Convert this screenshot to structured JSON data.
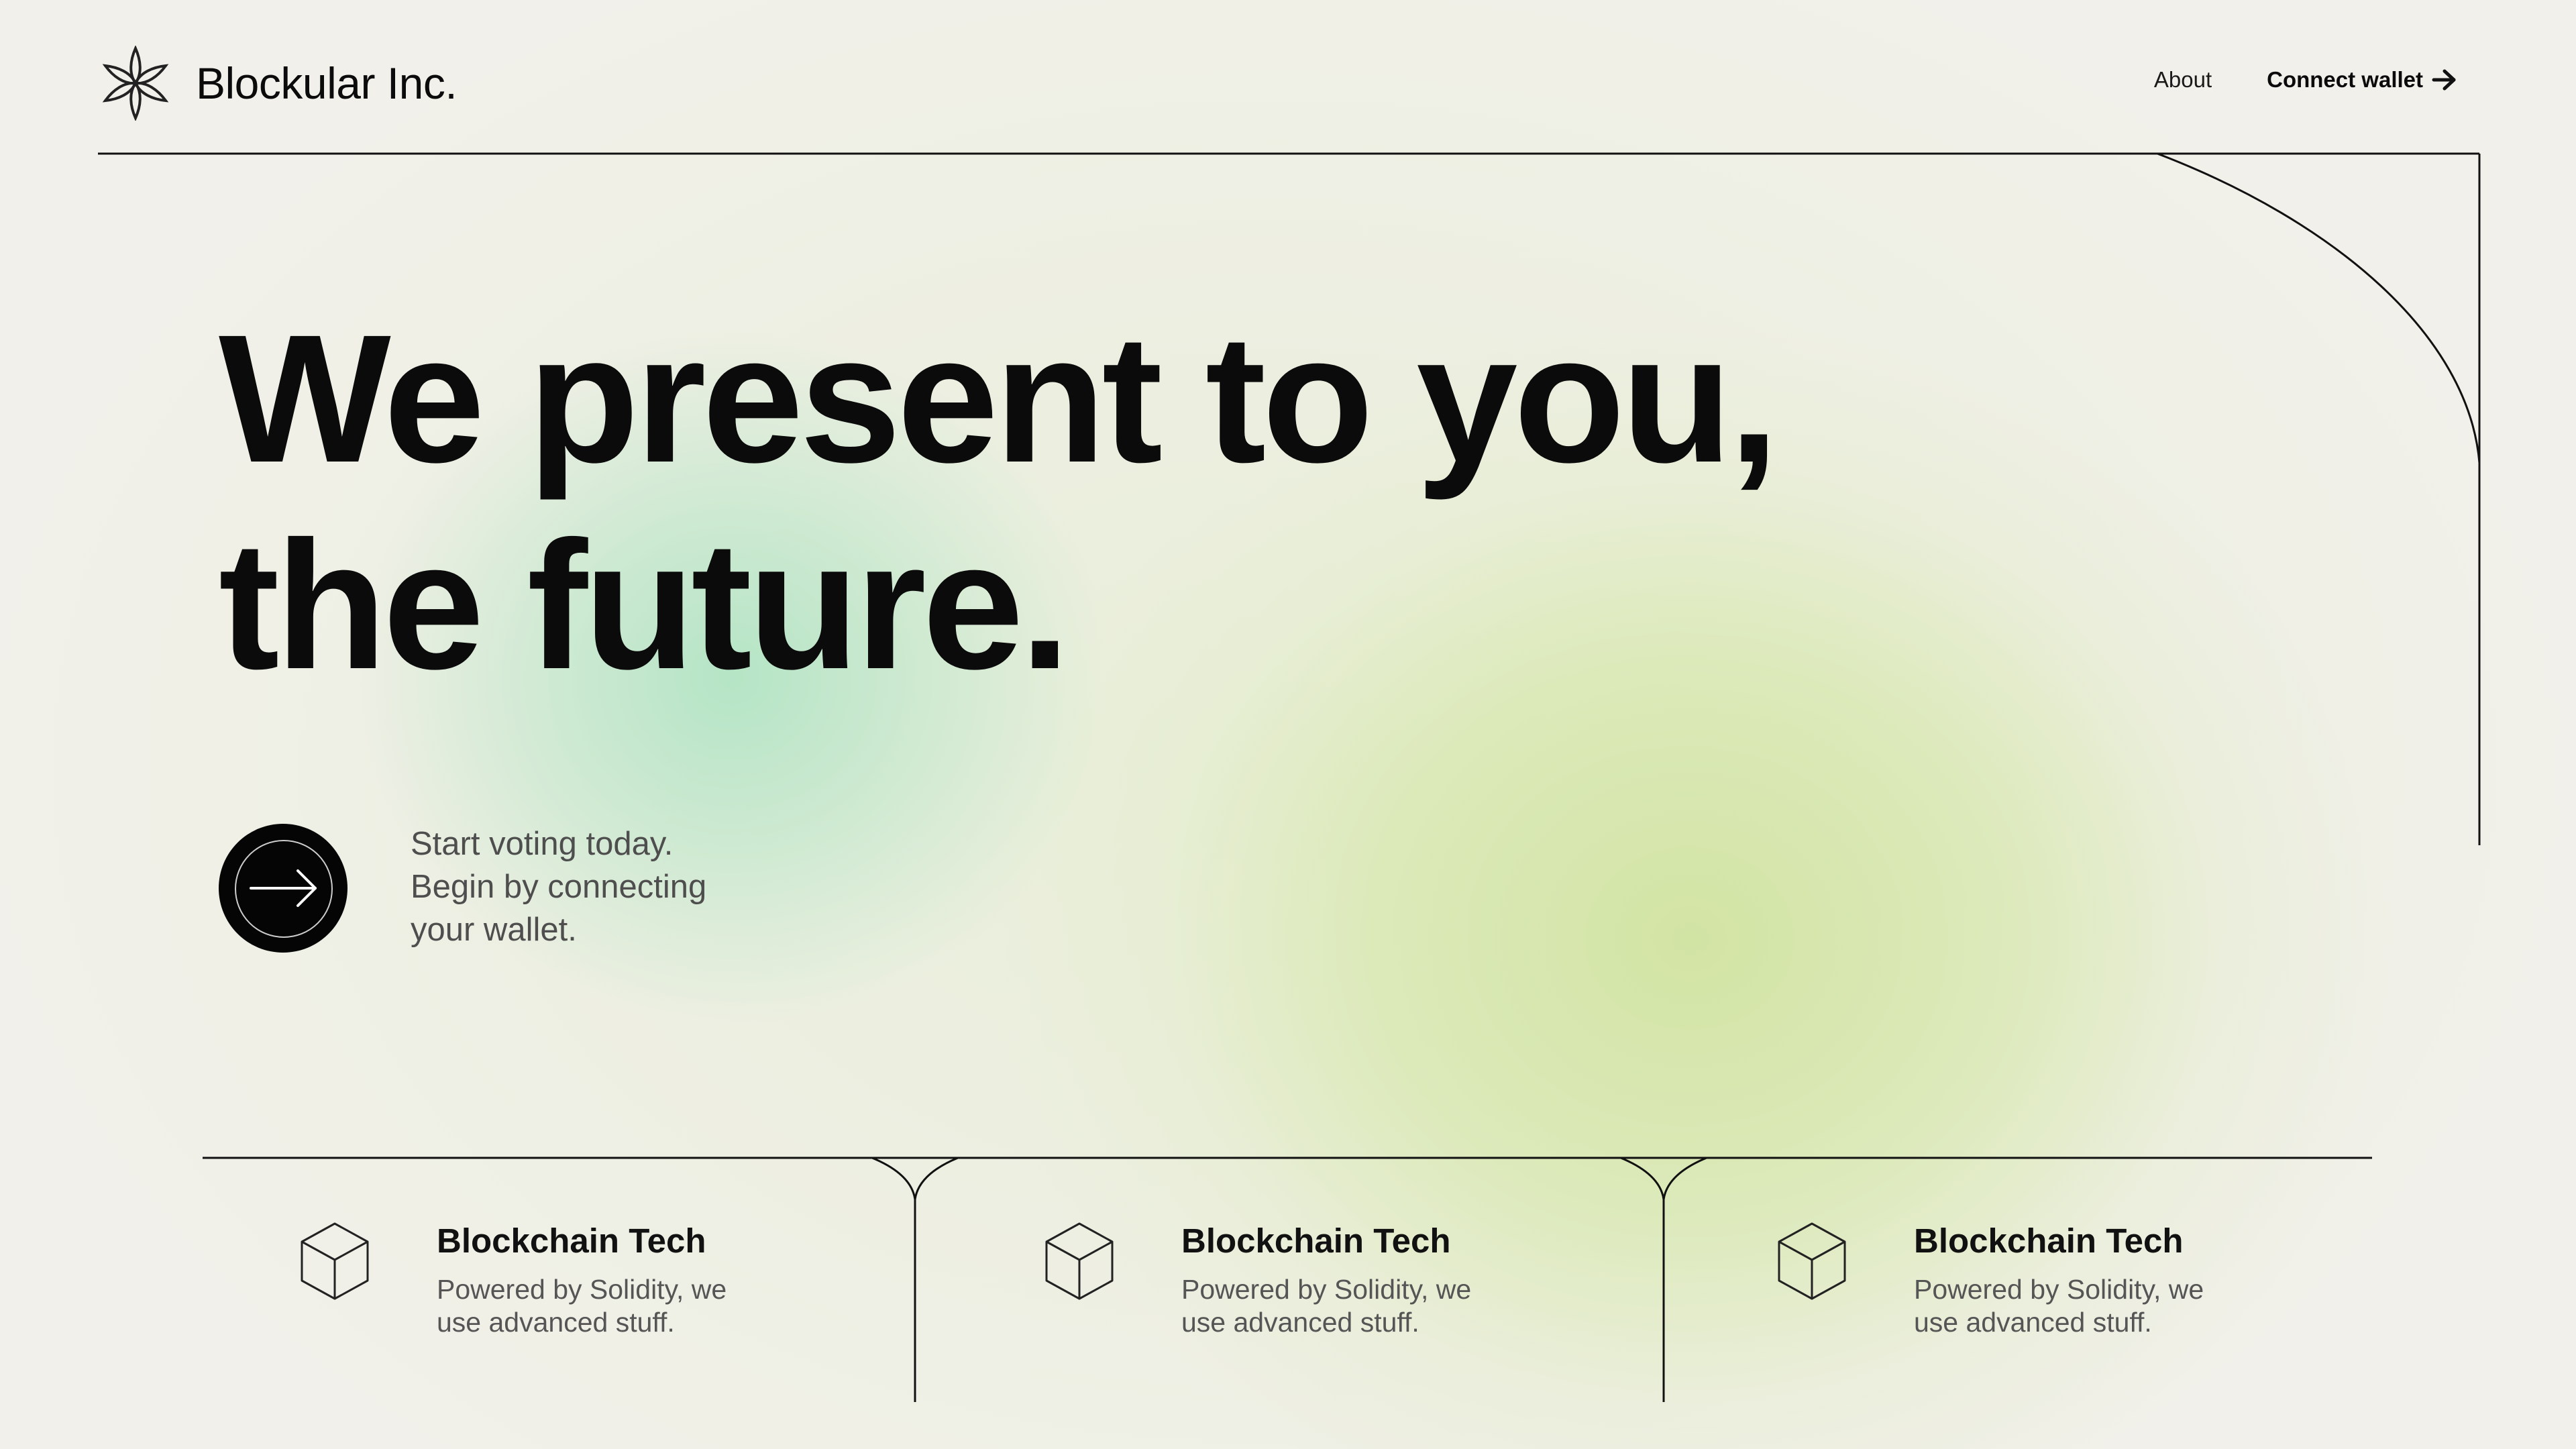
{
  "header": {
    "brand_name": "Blockular Inc.",
    "nav": {
      "about_label": "About",
      "connect_label": "Connect wallet"
    }
  },
  "hero": {
    "title_line1": "We present to you,",
    "title_line2": "the future.",
    "cta_lines": [
      "Start voting today.",
      "Begin by connecting",
      "your wallet."
    ]
  },
  "features": [
    {
      "icon": "cube-icon",
      "title": "Blockchain Tech",
      "desc_lines": [
        "Powered by Solidity, we",
        "use advanced stuff."
      ]
    },
    {
      "icon": "cube-icon",
      "title": "Blockchain Tech",
      "desc_lines": [
        "Powered by Solidity, we",
        "use advanced stuff."
      ]
    },
    {
      "icon": "cube-icon",
      "title": "Blockchain Tech",
      "desc_lines": [
        "Powered by Solidity, we",
        "use advanced stuff."
      ]
    }
  ],
  "colors": {
    "background": "#f2f0eb",
    "text": "#0b0b0b",
    "muted_text": "#555555",
    "mint_glow": "#b2e4c4",
    "lime_glow": "#d2e4a4"
  }
}
